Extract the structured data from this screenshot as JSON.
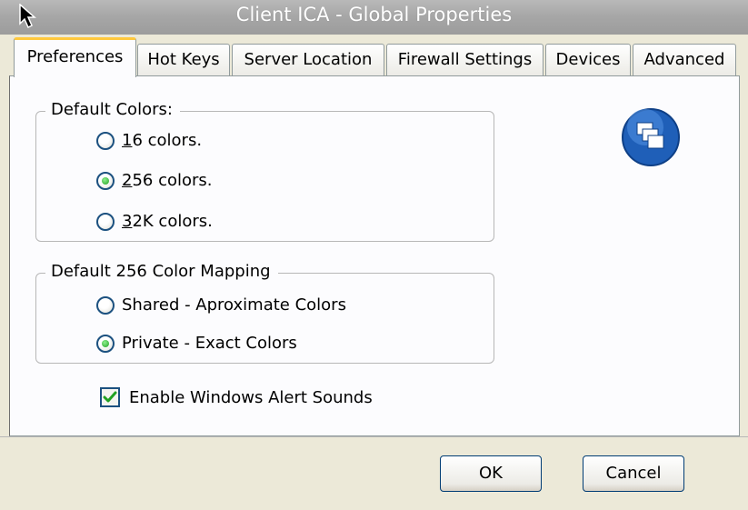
{
  "window": {
    "title": "Client ICA - Global Properties"
  },
  "tabs": [
    {
      "label": "Preferences",
      "active": true
    },
    {
      "label": "Hot Keys",
      "active": false
    },
    {
      "label": "Server Location",
      "active": false
    },
    {
      "label": "Firewall Settings",
      "active": false
    },
    {
      "label": "Devices",
      "active": false
    },
    {
      "label": "Advanced",
      "active": false
    }
  ],
  "default_colors": {
    "legend": "Default Colors:",
    "options": [
      {
        "mnemonic": "1",
        "rest": "6 colors.",
        "checked": false
      },
      {
        "mnemonic": "2",
        "rest": "56 colors.",
        "checked": true
      },
      {
        "mnemonic": "3",
        "rest": "2K colors.",
        "checked": false
      }
    ]
  },
  "color_mapping": {
    "legend": "Default 256 Color Mapping",
    "options": [
      {
        "label": "Shared - Aproximate Colors",
        "checked": false
      },
      {
        "label": "Private - Exact Colors",
        "checked": true
      }
    ]
  },
  "alert_sounds": {
    "label": "Enable Windows Alert Sounds",
    "checked": true
  },
  "buttons": {
    "ok": "OK",
    "cancel": "Cancel"
  },
  "icons": {
    "cursor": "mouse-cursor-icon",
    "app": "citrix-app-icon"
  },
  "colors": {
    "active_tab_accent": "#ffc83c",
    "radio_selected": "#22a022",
    "check_mark": "#21a121",
    "app_icon": "#1f5fb8"
  }
}
